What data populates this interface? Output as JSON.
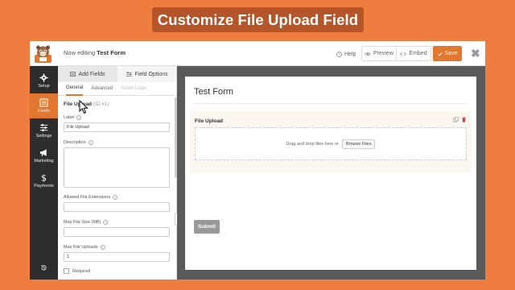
{
  "banner": {
    "title": "Customize File Upload Field"
  },
  "topbar": {
    "editing_prefix": "Now editing",
    "form_name": "Test Form",
    "help_label": "Help",
    "preview_label": "Preview",
    "embed_label": "Embed",
    "save_label": "Save",
    "close_glyph": "✖"
  },
  "leftnav": {
    "items": [
      {
        "label": "Setup",
        "icon": "gear-icon"
      },
      {
        "label": "Fields",
        "icon": "fields-list-icon",
        "active": true
      },
      {
        "label": "Settings",
        "icon": "sliders-icon"
      },
      {
        "label": "Marketing",
        "icon": "megaphone-icon"
      },
      {
        "label": "Payments",
        "icon": "dollar-icon"
      }
    ],
    "history_icon": "history-icon"
  },
  "panel": {
    "tab_add_fields": "Add Fields",
    "tab_field_options": "Field Options",
    "subtabs": [
      "General",
      "Advanced",
      "Smart Logic"
    ],
    "field_name": "File Upload",
    "field_id": "(ID #1)",
    "label_label": "Label",
    "label_value": "File Upload",
    "description_label": "Description",
    "allowed_ext_label": "Allowed File Extensions",
    "max_size_label": "Max File Size (MB)",
    "max_uploads_label": "Max File Uploads",
    "max_uploads_value": "1",
    "required_label": "Required"
  },
  "preview": {
    "form_title": "Test Form",
    "field_label": "File Upload",
    "dropzone_text": "Drag and drop files here or",
    "browse_label": "Browse Files",
    "submit_label": "Submit"
  },
  "colors": {
    "background": "#ee7d3f",
    "banner": "#b4552a",
    "accent": "#e27730",
    "nav": "#2d2d2d",
    "preview_bg": "#5a5a5a"
  }
}
